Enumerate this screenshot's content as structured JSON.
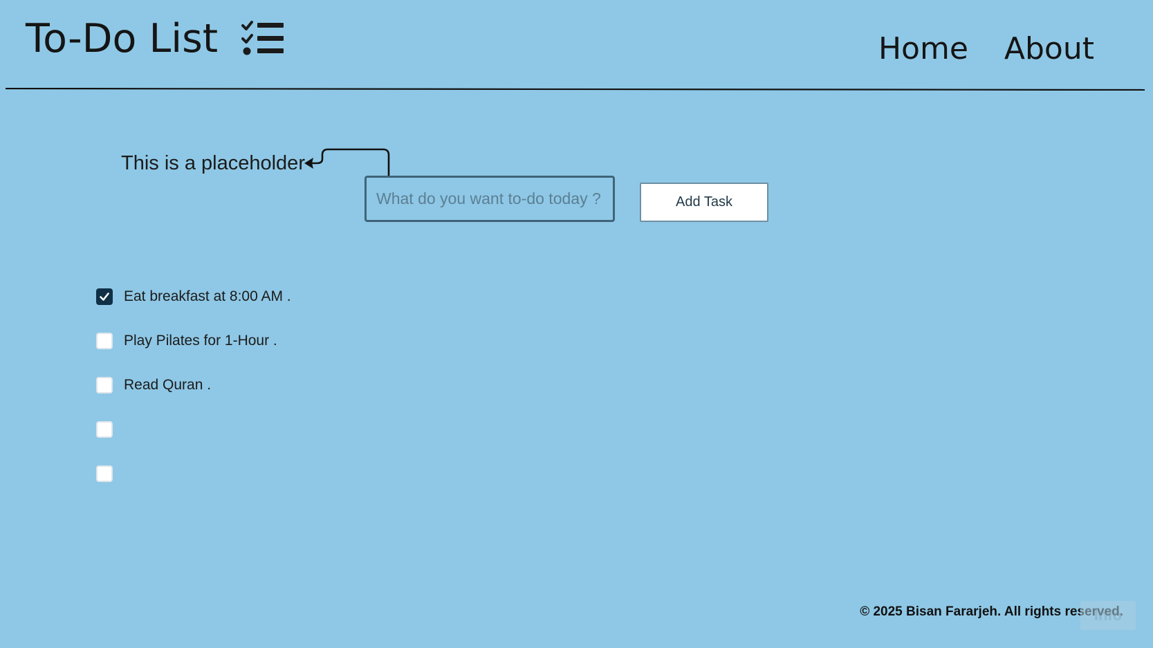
{
  "header": {
    "title": "To-Do List",
    "title_icon": "checklist-icon",
    "nav": [
      {
        "label": "Home"
      },
      {
        "label": "About"
      }
    ]
  },
  "input_area": {
    "hint_text": "This is a placeholder",
    "hint_icon": "curved-arrow-icon",
    "input_value": "",
    "input_placeholder": "What do you want to-do today ?",
    "add_button_label": "Add Task"
  },
  "tasks": [
    {
      "label": "Eat breakfast at 8:00 AM .",
      "checked": true
    },
    {
      "label": "Play Pilates for 1-Hour .",
      "checked": false
    },
    {
      "label": "Read Quran .",
      "checked": false
    },
    {
      "label": "",
      "checked": false
    },
    {
      "label": "",
      "checked": false
    }
  ],
  "footer": {
    "copyright": "© 2025 Bisan Fararjeh. All rights reserved.",
    "info_button_label": "Info"
  },
  "colors": {
    "background": "#8fc8e6",
    "checkbox_checked": "#0f3047",
    "text": "#1b1b1b"
  }
}
